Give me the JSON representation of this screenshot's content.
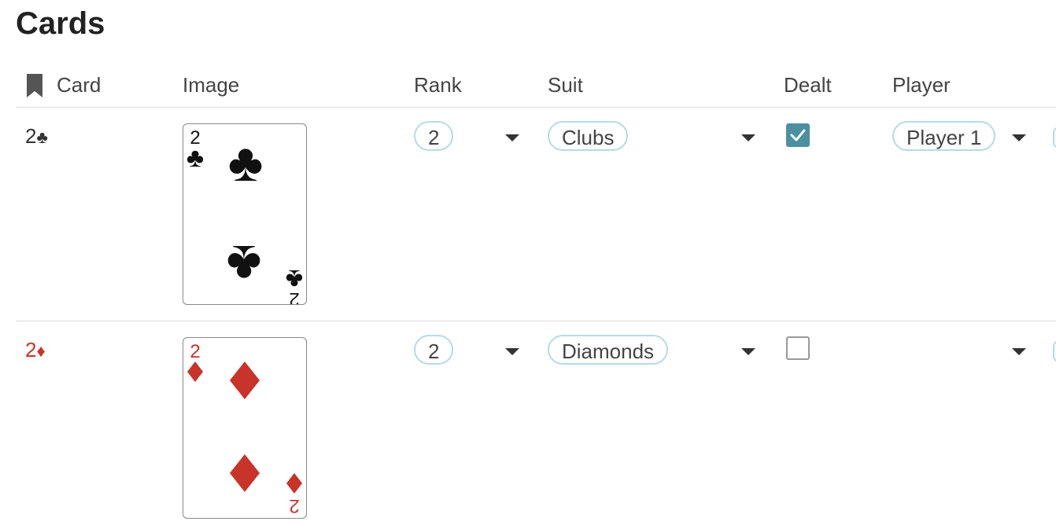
{
  "page": {
    "title": "Cards"
  },
  "table": {
    "headers": {
      "card": "Card",
      "image": "Image",
      "rank": "Rank",
      "suit": "Suit",
      "dealt": "Dealt",
      "player": "Player"
    },
    "rows": [
      {
        "card_rank": "2",
        "card_suit_symbol": "♣",
        "rank": "2",
        "suit": "Clubs",
        "dealt": true,
        "player": "Player 1",
        "color": "#111111",
        "image_rank": "2",
        "image_suit": "♣"
      },
      {
        "card_rank": "2",
        "card_suit_symbol": "♦",
        "rank": "2",
        "suit": "Diamonds",
        "dealt": false,
        "player": "",
        "color": "#c8332a",
        "image_rank": "2",
        "image_suit": "♦"
      }
    ]
  },
  "colors": {
    "accent_checkbox": "#4a90a0",
    "pill_border": "#b5dbe5",
    "red_suit": "#c8332a"
  },
  "icons": {
    "header_card": "bookmark-icon",
    "dropdown": "caret-down-icon",
    "checkbox_checked": "checkmark-icon"
  }
}
